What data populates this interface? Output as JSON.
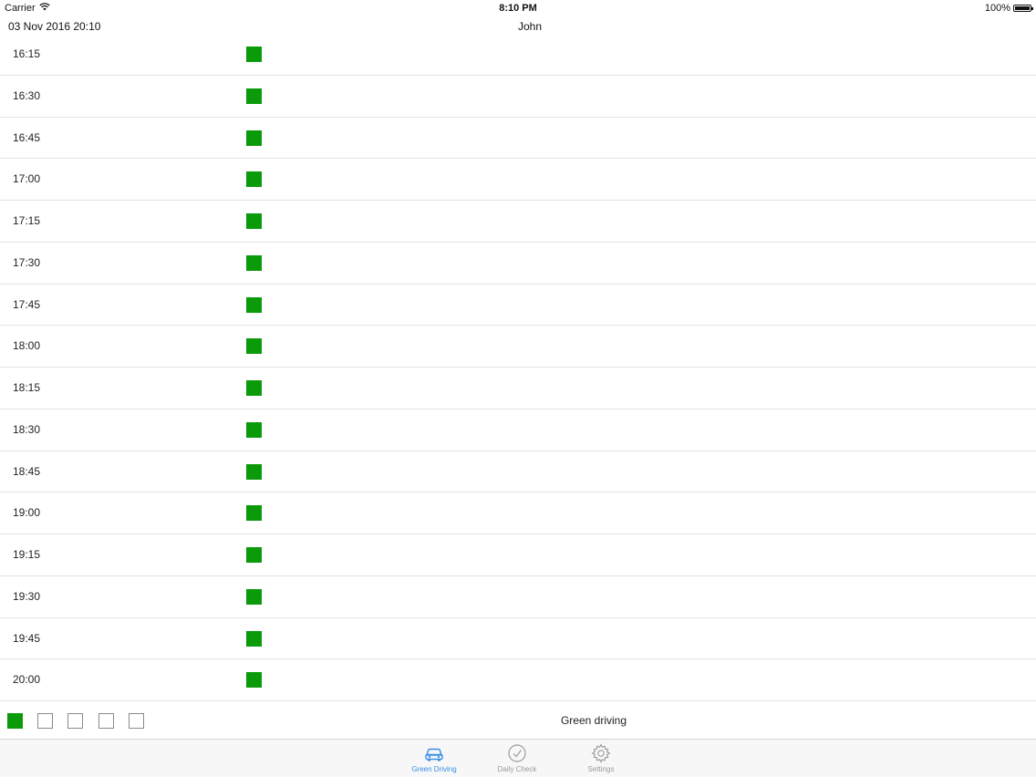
{
  "status_bar": {
    "carrier": "Carrier",
    "time": "8:10 PM",
    "battery": "100%"
  },
  "header": {
    "date": "03 Nov 2016 20:10",
    "name": "John"
  },
  "rows": [
    {
      "time": "16:15"
    },
    {
      "time": "16:30"
    },
    {
      "time": "16:45"
    },
    {
      "time": "17:00"
    },
    {
      "time": "17:15"
    },
    {
      "time": "17:30"
    },
    {
      "time": "17:45"
    },
    {
      "time": "18:00"
    },
    {
      "time": "18:15"
    },
    {
      "time": "18:30"
    },
    {
      "time": "18:45"
    },
    {
      "time": "19:00"
    },
    {
      "time": "19:15"
    },
    {
      "time": "19:30"
    },
    {
      "time": "19:45"
    },
    {
      "time": "20:00"
    }
  ],
  "legend": {
    "boxes": [
      {
        "filled": true
      },
      {
        "filled": false
      },
      {
        "filled": false
      },
      {
        "filled": false
      },
      {
        "filled": false
      }
    ],
    "label": "Green driving"
  },
  "tabs": [
    {
      "label": "Green Driving",
      "icon": "car-icon",
      "active": true
    },
    {
      "label": "Daily Check",
      "icon": "check-circle-icon",
      "active": false
    },
    {
      "label": "Settings",
      "icon": "gear-icon",
      "active": false
    }
  ],
  "colors": {
    "status_green": "#0a9a0a",
    "tab_active": "#3a8ee6",
    "tab_inactive": "#9a9a9a"
  }
}
